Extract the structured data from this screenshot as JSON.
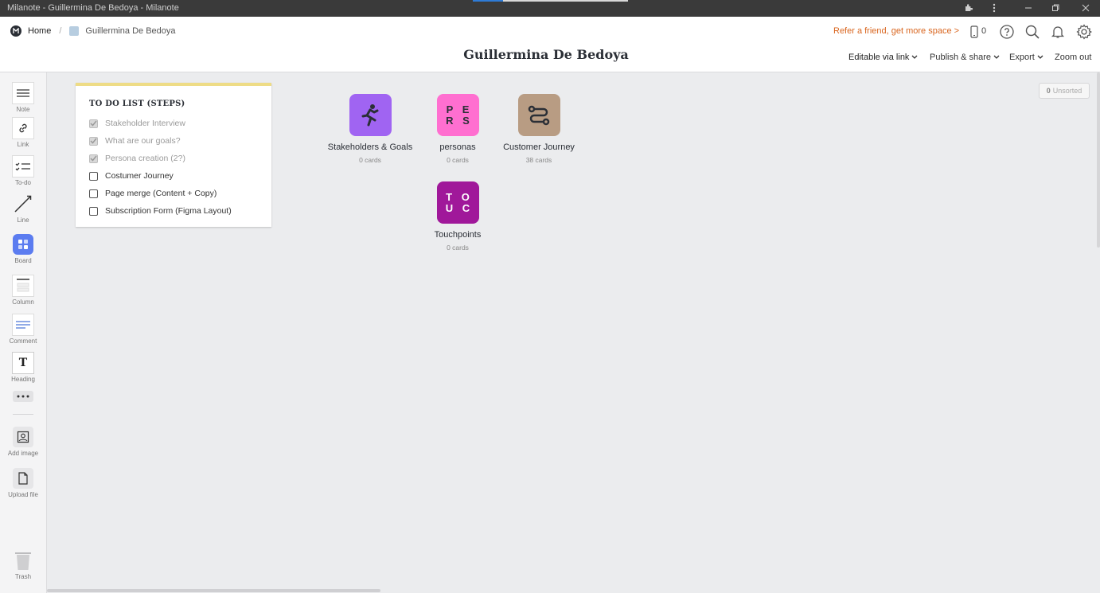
{
  "window": {
    "title": "Milanote - Guillermina De Bedoya - Milanote"
  },
  "breadcrumb": {
    "home": "Home",
    "separator": "/",
    "board": "Guillermina De Bedoya"
  },
  "header": {
    "refer_link": "Refer a friend, get more space >",
    "phone_count": "0",
    "page_title": "Guillermina De Bedoya",
    "menus": {
      "editable": "Editable via link",
      "publish": "Publish & share",
      "export": "Export",
      "zoom": "Zoom out"
    }
  },
  "toolbar": {
    "items": [
      {
        "label": "Note",
        "icon": "note-icon"
      },
      {
        "label": "Link",
        "icon": "link-icon"
      },
      {
        "label": "To-do",
        "icon": "todo-icon"
      },
      {
        "label": "Line",
        "icon": "line-icon"
      },
      {
        "label": "Board",
        "icon": "board-icon"
      },
      {
        "label": "Column",
        "icon": "column-icon"
      },
      {
        "label": "Comment",
        "icon": "comment-icon"
      },
      {
        "label": "Heading",
        "icon": "heading-icon"
      },
      {
        "label": "",
        "icon": "more-icon"
      },
      {
        "label": "Add image",
        "icon": "image-icon"
      },
      {
        "label": "Upload file",
        "icon": "file-icon"
      },
      {
        "label": "Trash",
        "icon": "trash-icon"
      }
    ],
    "heading_glyph": "T"
  },
  "todo": {
    "title": "TO DO LIST (STEPS)",
    "items": [
      {
        "text": "Stakeholder Interview",
        "done": true
      },
      {
        "text": "What are our goals?",
        "done": true
      },
      {
        "text": "Persona creation (2?)",
        "done": true
      },
      {
        "text": "Costumer Journey",
        "done": false
      },
      {
        "text": "Page merge (Content + Copy)",
        "done": false
      },
      {
        "text": "Subscription Form (Figma Layout)",
        "done": false
      }
    ]
  },
  "boards": [
    {
      "name": "Stakeholders & Goals",
      "count": "0 cards",
      "color": "#a064f2",
      "icon": "running-person-icon"
    },
    {
      "name": "personas",
      "count": "0 cards",
      "color": "#ff6fd0",
      "icon_text_1": "P E",
      "icon_text_2": "R S"
    },
    {
      "name": "Customer Journey",
      "count": "38 cards",
      "color": "#b89c83",
      "icon": "route-icon"
    },
    {
      "name": "Touchpoints",
      "count": "0 cards",
      "color": "#a0189a",
      "icon_text_1": "T O",
      "icon_text_2": "U C"
    }
  ],
  "unsorted": {
    "count": "0",
    "label": "Unsorted"
  },
  "colors": {
    "accent_orange": "#d9651e",
    "board_tool_blue": "#5b7cf0",
    "todo_border": "#eedc86"
  }
}
